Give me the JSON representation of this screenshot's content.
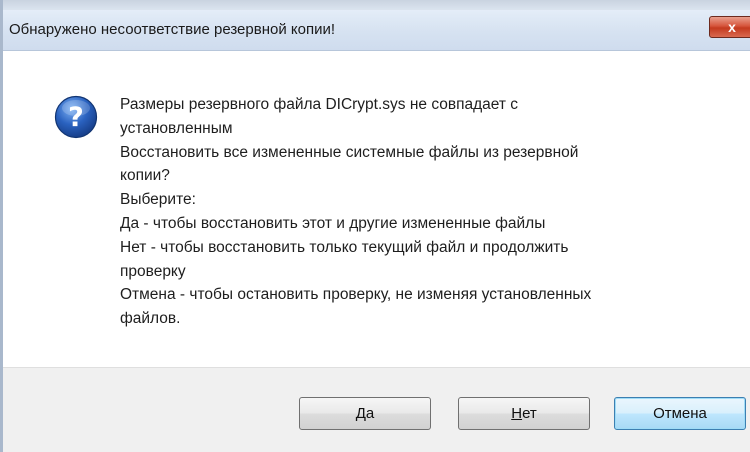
{
  "dialog": {
    "title": "Обнаружено несоответствие резервной копии!",
    "close_label": "x"
  },
  "message": {
    "icon": "question-icon",
    "lines": [
      "Размеры резервного файла DICrypt.sys не совпадает с",
      "установленным",
      "Восстановить все измененные системные файлы из резервной",
      "копии?",
      "Выберите:",
      "Да - чтобы восстановить этот и другие измененные файлы",
      "Нет - чтобы восстановить только текущий файл и продолжить",
      "проверку",
      "Отмена - чтобы остановить проверку, не изменяя установленных",
      "файлов."
    ]
  },
  "buttons": {
    "yes": {
      "accel": "Д",
      "rest": "а"
    },
    "no": {
      "accel": "Н",
      "rest": "ет"
    },
    "cancel": {
      "label": "Отмена"
    }
  },
  "colors": {
    "titlebar": "#d6e2f1",
    "close_button": "#c43a1f",
    "icon_blue": "#2a62c0",
    "footer": "#f0f0f0",
    "default_button_border": "#3c7fb1"
  }
}
